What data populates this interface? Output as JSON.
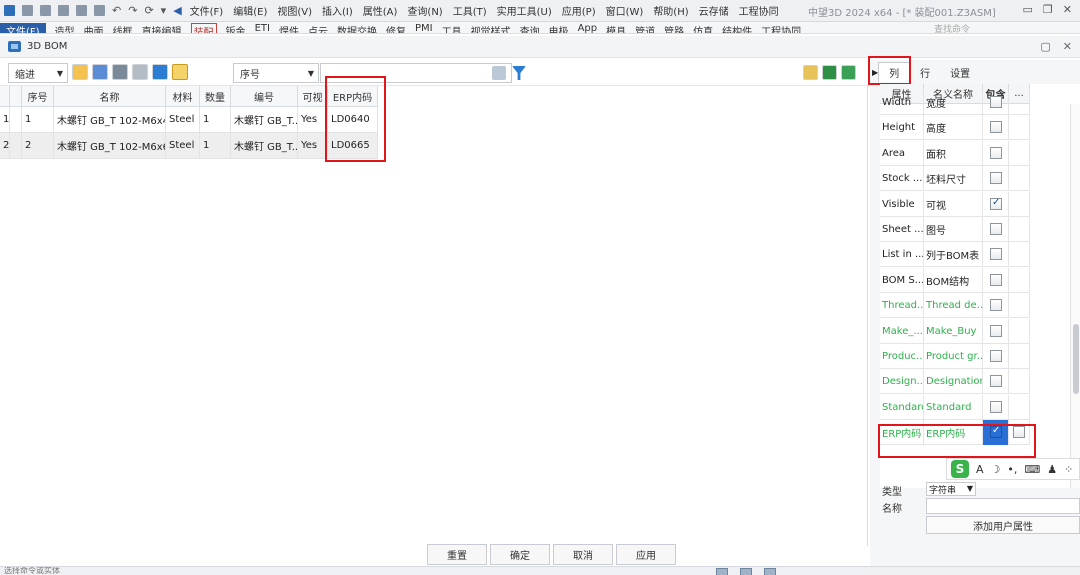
{
  "titlebar": {
    "menus": [
      "文件(F)",
      "编辑(E)",
      "视图(V)",
      "插入(I)",
      "属性(A)",
      "查询(N)",
      "工具(T)",
      "实用工具(U)",
      "应用(P)",
      "窗口(W)",
      "帮助(H)",
      "云存储",
      "工程协同"
    ],
    "app_title": "中望3D 2024 x64 - [* 装配001.Z3ASM]"
  },
  "ribbon": {
    "file_tab": "文件(F)",
    "tabs": [
      "造型",
      "曲面",
      "线框",
      "直接编辑",
      "装配",
      "钣金",
      "ETI",
      "焊件",
      "点云",
      "数据交换",
      "修复",
      "PMI",
      "工具",
      "视觉样式",
      "查询",
      "电极",
      "App",
      "模具",
      "管道",
      "管路",
      "仿真",
      "结构件",
      "工程协同"
    ],
    "active_tab": "装配",
    "search_placeholder": "查找命令"
  },
  "panel": {
    "title": "3D BOM"
  },
  "toolbar": {
    "view_mode": "缩进",
    "field_select": "序号",
    "search_value": ""
  },
  "grid": {
    "headers": [
      "序号",
      "名称",
      "材料",
      "数量",
      "编号",
      "可视",
      "ERP内码"
    ],
    "rows": [
      {
        "idx": "1",
        "seq": "1",
        "name": "木螺钉 GB_T 102-M6x40",
        "material": "Steel",
        "qty": "1",
        "code": "木螺钉 GB_T...",
        "visible": "Yes",
        "erp": "LD0640"
      },
      {
        "idx": "2",
        "seq": "2",
        "name": "木螺钉 GB_T 102-M6x65",
        "material": "Steel",
        "qty": "1",
        "code": "木螺钉 GB_T...",
        "visible": "Yes",
        "erp": "LD0665"
      }
    ]
  },
  "footer": {
    "reset": "重置",
    "ok": "确定",
    "cancel": "取消",
    "apply": "应用",
    "status_hint": "选择命令或实体"
  },
  "right_panel": {
    "tabs": [
      "列",
      "行",
      "设置"
    ],
    "headers": [
      "属性",
      "名义名称",
      "包含",
      "..."
    ],
    "properties": [
      {
        "attr": "Width",
        "name": "宽度",
        "checked": false,
        "custom": false
      },
      {
        "attr": "Height",
        "name": "高度",
        "checked": false,
        "custom": false
      },
      {
        "attr": "Area",
        "name": "面积",
        "checked": false,
        "custom": false
      },
      {
        "attr": "Stock ...",
        "name": "坯料尺寸",
        "checked": false,
        "custom": false
      },
      {
        "attr": "Visible",
        "name": "可视",
        "checked": true,
        "custom": false
      },
      {
        "attr": "Sheet ...",
        "name": "图号",
        "checked": false,
        "custom": false
      },
      {
        "attr": "List in ...",
        "name": "列于BOM表",
        "checked": false,
        "custom": false
      },
      {
        "attr": "BOM S...",
        "name": "BOM结构",
        "checked": false,
        "custom": false
      },
      {
        "attr": "Thread...",
        "name": "Thread de...",
        "checked": false,
        "custom": true
      },
      {
        "attr": "Make_...",
        "name": "Make_Buy",
        "checked": false,
        "custom": true
      },
      {
        "attr": "Produc...",
        "name": "Product gr...",
        "checked": false,
        "custom": true
      },
      {
        "attr": "Design...",
        "name": "Designation",
        "checked": false,
        "custom": true
      },
      {
        "attr": "Standard",
        "name": "Standard",
        "checked": false,
        "custom": true
      },
      {
        "attr": "ERP内码",
        "name": "ERP内码",
        "checked": true,
        "custom": true
      }
    ],
    "type_label": "类型",
    "type_value": "字符串",
    "name_label": "名称",
    "add_button": "添加用户属性",
    "ime_logo": "S",
    "ime_icons": [
      "A",
      "☽",
      "•,",
      "⌨",
      "♟",
      "⁘"
    ]
  },
  "colors": {
    "highlight_red": "#e0161b",
    "custom_green": "#2bb24a",
    "selected_blue": "#2a6fd6"
  }
}
